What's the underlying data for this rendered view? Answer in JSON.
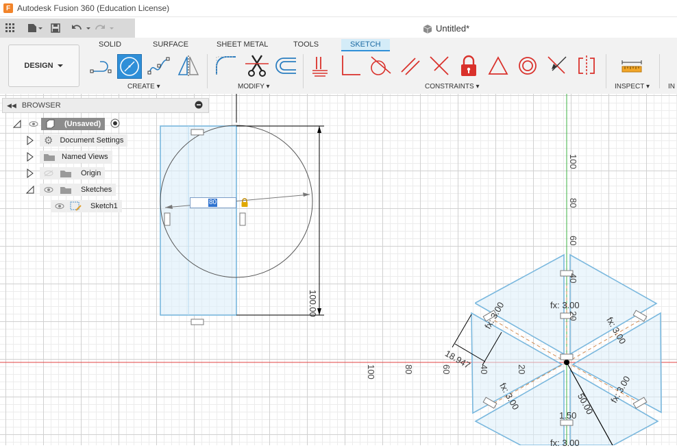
{
  "window": {
    "title": "Autodesk Fusion 360 (Education License)",
    "logo_letter": "F"
  },
  "document": {
    "title": "Untitled*"
  },
  "workspace": {
    "label": "DESIGN"
  },
  "tabs": [
    "SOLID",
    "SURFACE",
    "SHEET METAL",
    "TOOLS",
    "SKETCH"
  ],
  "groups": {
    "create": "CREATE",
    "modify": "MODIFY",
    "constraints": "CONSTRAINTS",
    "inspect": "INSPECT",
    "insert_partial": "IN"
  },
  "browser": {
    "title": "BROWSER",
    "items": [
      {
        "label": "(Unsaved)"
      },
      {
        "label": "Document Settings"
      },
      {
        "label": "Named Views"
      },
      {
        "label": "Origin"
      },
      {
        "label": "Sketches"
      },
      {
        "label": "Sketch1"
      }
    ]
  },
  "sketch": {
    "dimension_input_value": "80",
    "dimensions": {
      "rect_height": "100.00",
      "hex_dim_a": "fx: 3.00",
      "hex_dim_b": "fx: 3.00",
      "hex_dim_c": "fx: 3.00",
      "hex_dim_d": "fx: 3.00",
      "hex_dim_e": "fx: 3.00",
      "hex_offset": "18.947",
      "hex_radius": "50.00",
      "hex_bottom": "1.50",
      "hex_bottom2": "fx: 3.00"
    },
    "axis_labels_vertical": [
      "100",
      "80",
      "60",
      "40",
      "20"
    ],
    "axis_labels_horizontal": [
      "100",
      "80",
      "60",
      "40",
      "20"
    ]
  },
  "colors": {
    "accent": "#2f8fd8",
    "sketch_line": "#7ab8de",
    "red": "#d9312b",
    "x_axis": "#e04040",
    "y_axis": "#3cb043"
  }
}
